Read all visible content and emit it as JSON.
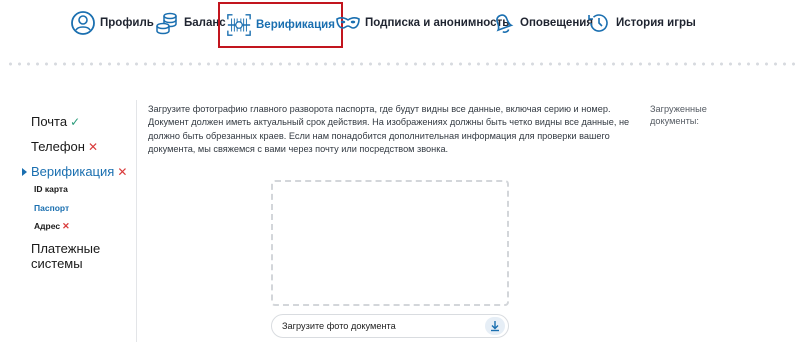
{
  "nav": {
    "items": [
      {
        "key": "profile",
        "label": "Профиль",
        "icon": "user-circle-icon"
      },
      {
        "key": "balance",
        "label": "Баланс",
        "icon": "coins-icon"
      },
      {
        "key": "verification",
        "label": "Верификация",
        "icon": "verification-icon",
        "active": true
      },
      {
        "key": "subscription",
        "label": "Подписка и анонимность",
        "icon": "mask-icon"
      },
      {
        "key": "notifications",
        "label": "Оповещения",
        "icon": "bell-icon"
      },
      {
        "key": "history",
        "label": "История игры",
        "icon": "history-icon"
      }
    ],
    "active_outline_color": "#c2151e",
    "accent_color": "#1a6fb0"
  },
  "sidebar": {
    "items": [
      {
        "label": "Почта",
        "status": "✓"
      },
      {
        "label": "Телефон",
        "status": "✕"
      },
      {
        "label": "Верификация",
        "status": "✕",
        "active": true
      },
      {
        "label": "Платежные",
        "label2": "системы"
      }
    ],
    "sub_items": [
      {
        "label": "ID карта"
      },
      {
        "label": "Паспорт",
        "active": true
      },
      {
        "label": "Адрес",
        "status": "✕"
      }
    ]
  },
  "main": {
    "instructions": "Загрузите фотографию главного разворота паспорта, где будут видны все данные, включая серию и номер. Документ должен иметь актуальный срок действия. На изображениях должны быть четко видны все данные, не должно быть обрезанных краев. Если нам понадобится дополнительная информация для проверки вашего документа, мы свяжемся с вами через почту или посредством звонка.",
    "uploaded_label": "Загруженные документы:",
    "upload_field_text": "Загрузите фото документа",
    "upload_icon": "download-arrow-icon"
  }
}
